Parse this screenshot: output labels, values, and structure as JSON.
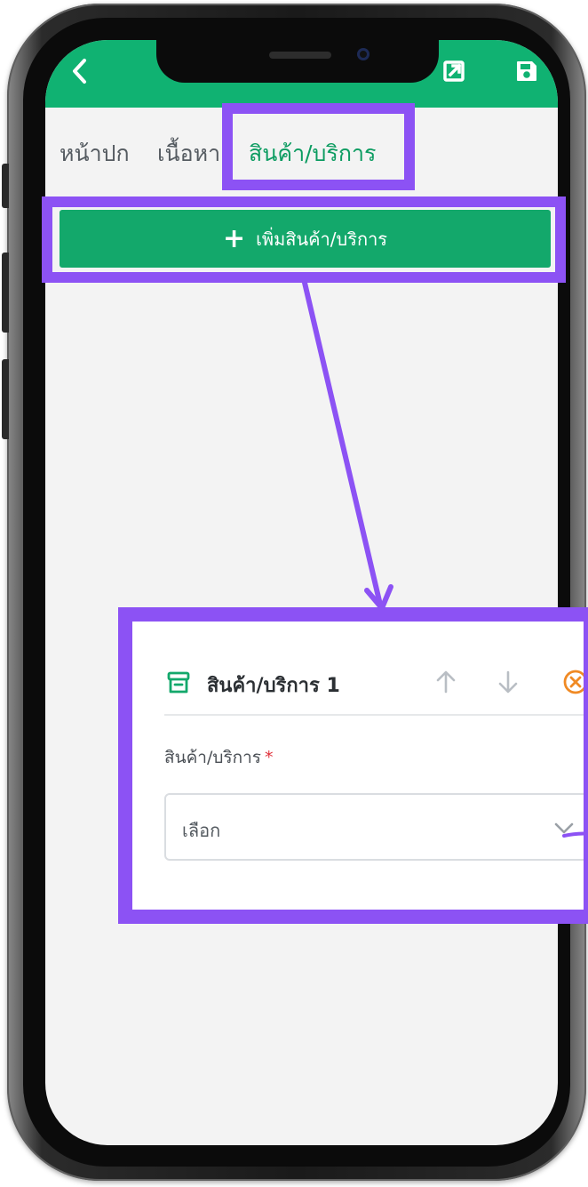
{
  "header": {
    "back_icon": "chevron-left-icon",
    "open_icon": "external-link-icon",
    "save_icon": "floppy-disk-icon",
    "color": "#10b272"
  },
  "tabs": [
    {
      "label": "หน้าปก",
      "active": false
    },
    {
      "label": "เนื้อหา",
      "active": false
    },
    {
      "label": "สินค้า/บริการ",
      "active": true
    }
  ],
  "add_button": {
    "label": "เพิ่มสินค้า/บริการ",
    "icon": "plus-icon"
  },
  "product_card": {
    "title": "สินค้า/บริการ 1",
    "title_icon": "archive-box-icon",
    "field_label": "สินค้า/บริการ",
    "required_mark": "*",
    "select_placeholder": "เลือก"
  },
  "colors": {
    "accent": "#13a86b",
    "annotation": "#8c52f4",
    "required": "#e0323b"
  }
}
